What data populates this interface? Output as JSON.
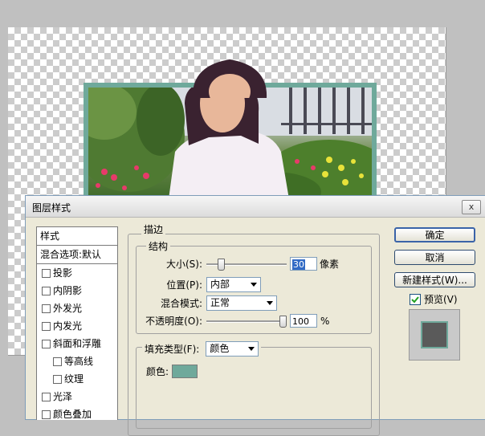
{
  "dialog": {
    "title": "图层样式",
    "close_label": "x"
  },
  "styles_list": {
    "header": "样式",
    "blend_options": "混合选项:默认",
    "items": [
      {
        "label": "投影",
        "checked": false,
        "indent": false
      },
      {
        "label": "内阴影",
        "checked": false,
        "indent": false
      },
      {
        "label": "外发光",
        "checked": false,
        "indent": false
      },
      {
        "label": "内发光",
        "checked": false,
        "indent": false
      },
      {
        "label": "斜面和浮雕",
        "checked": false,
        "indent": false
      },
      {
        "label": "等高线",
        "checked": false,
        "indent": true
      },
      {
        "label": "纹理",
        "checked": false,
        "indent": true
      },
      {
        "label": "光泽",
        "checked": false,
        "indent": false
      },
      {
        "label": "颜色叠加",
        "checked": false,
        "indent": false
      }
    ]
  },
  "stroke": {
    "section_title": "描边",
    "structure_title": "结构",
    "size_label": "大小(S):",
    "size_value": "30",
    "size_unit": "像素",
    "size_slider_fraction": 0.15,
    "position_label": "位置(P):",
    "position_value": "内部",
    "blend_mode_label": "混合模式:",
    "blend_mode_value": "正常",
    "opacity_label": "不透明度(O):",
    "opacity_value": "100",
    "opacity_unit": "%",
    "opacity_slider_fraction": 1.0,
    "fill_type_label": "填充类型(F):",
    "fill_type_value": "颜色",
    "color_label": "颜色:",
    "color_hex": "#6fa99b"
  },
  "buttons": {
    "ok": "确定",
    "cancel": "取消",
    "new_style": "新建样式(W)...",
    "preview_label": "预览(V)",
    "preview_checked": true
  }
}
